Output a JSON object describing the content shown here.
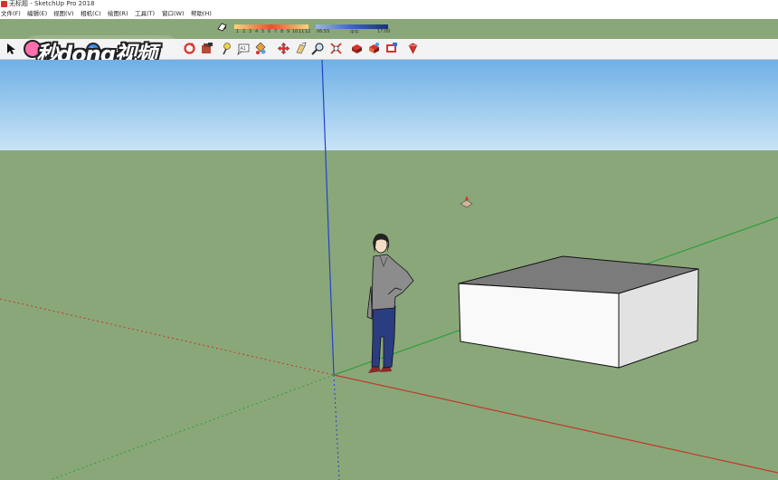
{
  "window": {
    "title": "无标题 - SketchUp Pro 2018"
  },
  "menu": [
    {
      "label": "文件(F)"
    },
    {
      "label": "编辑(E)"
    },
    {
      "label": "视图(V)"
    },
    {
      "label": "相机(C)"
    },
    {
      "label": "绘图(R)"
    },
    {
      "label": "工具(T)"
    },
    {
      "label": "窗口(W)"
    },
    {
      "label": "帮助(H)"
    }
  ],
  "shadows": {
    "months": [
      "1",
      "2",
      "3",
      "4",
      "5",
      "6",
      "7",
      "8",
      "9",
      "10",
      "11",
      "12"
    ],
    "time_start": "06:55",
    "time_mid": "中午",
    "time_end": "17:00"
  },
  "watermark": {
    "text": "秒dong视频"
  },
  "toolbar_icons": [
    "select-arrow",
    "rotate",
    "open-folder",
    "paint",
    "eraser",
    "tape",
    "text",
    "3d-text",
    "paint-bucket",
    "move",
    "push-pull",
    "zoom",
    "zoom-extents",
    "components",
    "warehouse",
    "extension",
    "style",
    "ruby"
  ],
  "colors": {
    "sky_top": "#6fb0e6",
    "sky_bottom": "#c9e3f6",
    "ground": "#8aa77a",
    "red_axis": "#c0392b",
    "green_axis": "#2e9e3a",
    "blue_axis": "#2342c8"
  }
}
